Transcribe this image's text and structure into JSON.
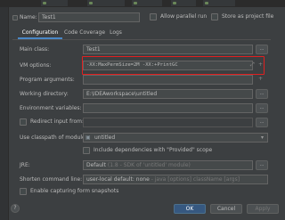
{
  "header": {
    "name_label": "Name:",
    "name_value": "Test1",
    "allow_parallel_label": "Allow parallel run",
    "store_as_project_file_label": "Store as project file"
  },
  "tabs": [
    {
      "label": "Configuration",
      "active": true
    },
    {
      "label": "Code Coverage",
      "active": false
    },
    {
      "label": "Logs",
      "active": false
    }
  ],
  "form": {
    "main_class_label": "Main class:",
    "main_class_value": "Test1",
    "vm_options_label": "VM options:",
    "vm_options_value": "-XX:MaxPermSize=2M -XX:+PrintGC",
    "program_args_label": "Program arguments:",
    "working_dir_label": "Working directory:",
    "working_dir_value": "E:\\IDEAworkspace\\untitled",
    "env_vars_label": "Environment variables:",
    "redirect_label": "Redirect input from:",
    "classpath_label": "Use classpath of module:",
    "classpath_value": "untitled",
    "include_provided_label": "Include dependencies with \"Provided\" scope",
    "jre_label": "JRE:",
    "jre_value": "Default",
    "jre_hint": "(1.8 - SDK of 'untitled' module)",
    "shorten_label": "Shorten command line:",
    "shorten_value": "user-local default: none",
    "shorten_hint": "- java [options] className [args]",
    "snapshots_label": "Enable capturing form snapshots"
  },
  "buttons": {
    "ok": "OK",
    "cancel": "Cancel",
    "apply": "Apply"
  },
  "icons": {
    "browse": "...",
    "expand": "⤢",
    "plus": "+",
    "dropdown": "▾",
    "folder": "▣",
    "help": "?"
  },
  "colors": {
    "background": "#3c3f41",
    "field": "#45494a",
    "accent": "#4a88c7",
    "primary_button": "#365880",
    "highlight_box": "#e02020"
  }
}
